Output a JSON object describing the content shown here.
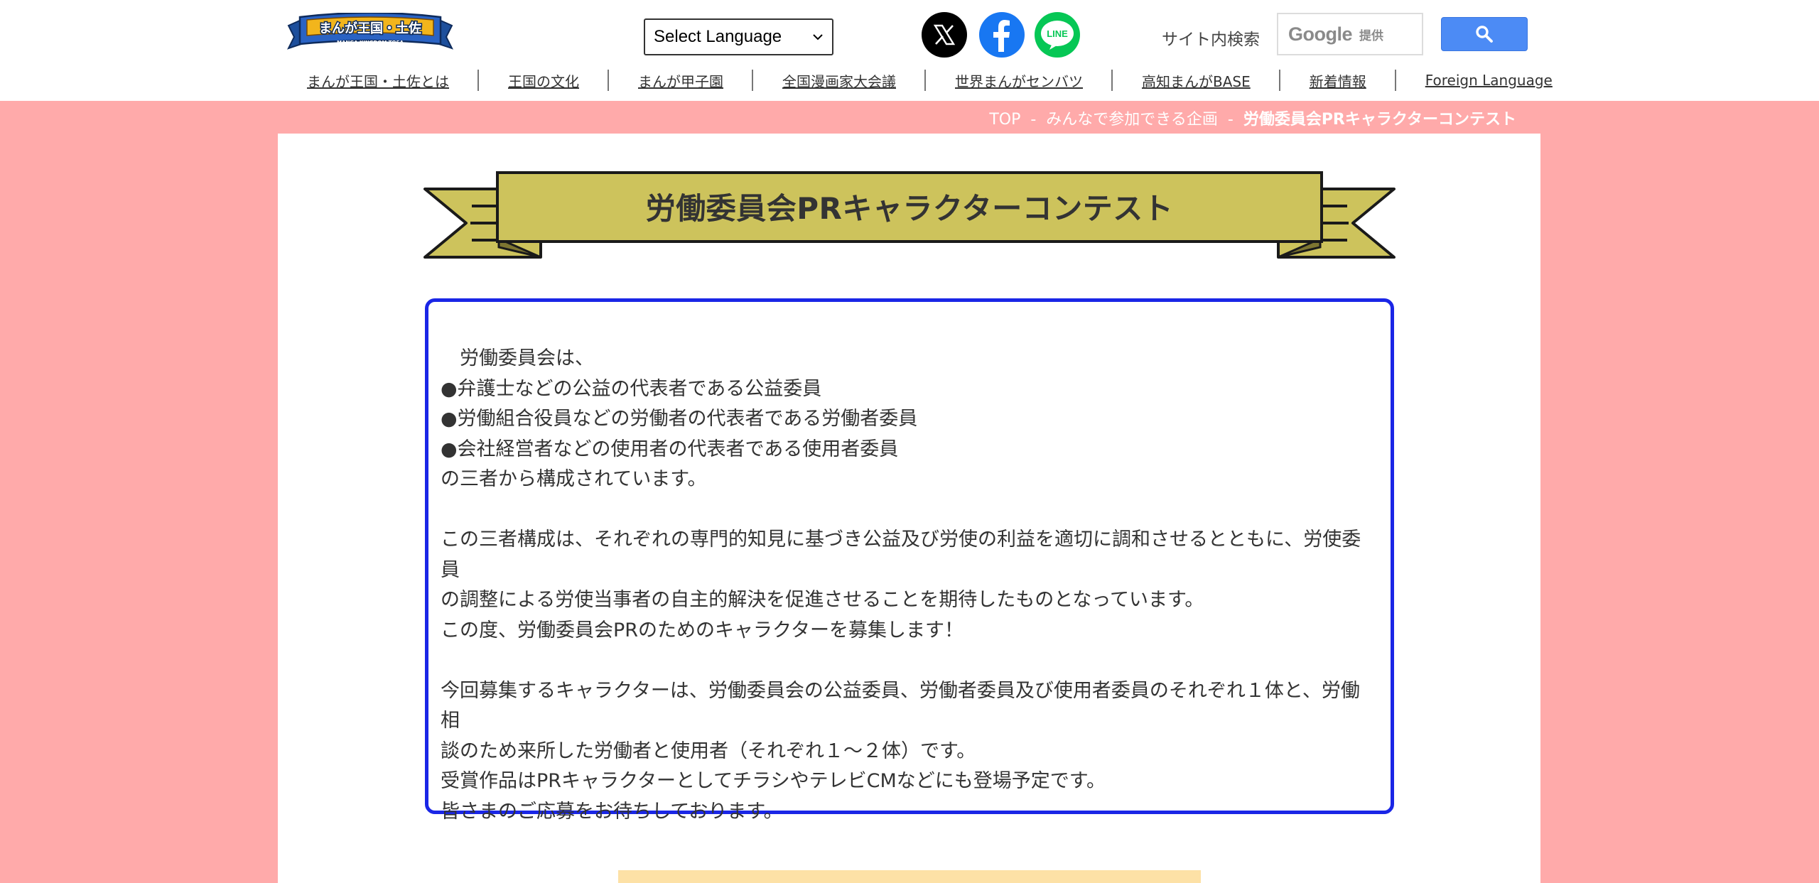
{
  "header": {
    "logo_text": "まんが王国・土佐",
    "logo_subtext": "MANGA KINGDOM TOSA",
    "language_select": "Select Language",
    "site_search_label": "サイト内検索",
    "google_text": "Google",
    "google_provided": "提供"
  },
  "nav": {
    "items": [
      {
        "label": "まんが王国・土佐とは"
      },
      {
        "label": "王国の文化"
      },
      {
        "label": "まんが甲子園"
      },
      {
        "label": "全国漫画家大会議"
      },
      {
        "label": "世界まんがセンバツ"
      },
      {
        "label": "高知まんがBASE"
      },
      {
        "label": "新着情報"
      },
      {
        "label": "Foreign Language"
      }
    ]
  },
  "breadcrumb": {
    "top": "TOP",
    "separator": "-",
    "parent": "みんなで参加できる企画",
    "current": "労働委員会PRキャラクターコンテスト"
  },
  "page": {
    "title": "労働委員会PRキャラクターコンテスト",
    "body": "　労働委員会は、\n●弁護士などの公益の代表者である公益委員\n●労働組合役員などの労働者の代表者である労働者委員\n●会社経営者などの使用者の代表者である使用者委員\nの三者から構成されています。\n\nこの三者構成は、それぞれの専門的知見に基づき公益及び労使の利益を適切に調和させるとともに、労使委員\nの調整による労使当事者の自主的解決を促進させることを期待したものとなっています。\nこの度、労働委員会PRのためのキャラクターを募集します！\n\n今回募集するキャラクターは、労働委員会の公益委員、労働者委員及び使用者委員のそれぞれ１体と、労働相\n談のため来所した労働者と使用者（それぞれ１～２体）です。\n受賞作品はPRキャラクターとしてチラシやテレビCMなどにも登場予定です。\n皆さまのご応募をお待ちしております。"
  },
  "colors": {
    "pink_band": "#ffaaaa",
    "ribbon_fill": "#cdc35c",
    "content_border": "#1a26e6",
    "search_button": "#4c8bf5"
  }
}
